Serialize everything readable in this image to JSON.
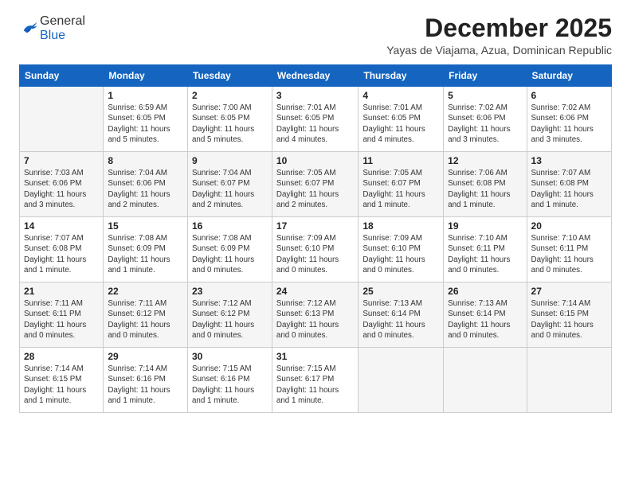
{
  "header": {
    "logo_general": "General",
    "logo_blue": "Blue",
    "month": "December 2025",
    "location": "Yayas de Viajama, Azua, Dominican Republic"
  },
  "weekdays": [
    "Sunday",
    "Monday",
    "Tuesday",
    "Wednesday",
    "Thursday",
    "Friday",
    "Saturday"
  ],
  "weeks": [
    [
      {
        "day": "",
        "info": ""
      },
      {
        "day": "1",
        "info": "Sunrise: 6:59 AM\nSunset: 6:05 PM\nDaylight: 11 hours\nand 5 minutes."
      },
      {
        "day": "2",
        "info": "Sunrise: 7:00 AM\nSunset: 6:05 PM\nDaylight: 11 hours\nand 5 minutes."
      },
      {
        "day": "3",
        "info": "Sunrise: 7:01 AM\nSunset: 6:05 PM\nDaylight: 11 hours\nand 4 minutes."
      },
      {
        "day": "4",
        "info": "Sunrise: 7:01 AM\nSunset: 6:05 PM\nDaylight: 11 hours\nand 4 minutes."
      },
      {
        "day": "5",
        "info": "Sunrise: 7:02 AM\nSunset: 6:06 PM\nDaylight: 11 hours\nand 3 minutes."
      },
      {
        "day": "6",
        "info": "Sunrise: 7:02 AM\nSunset: 6:06 PM\nDaylight: 11 hours\nand 3 minutes."
      }
    ],
    [
      {
        "day": "7",
        "info": "Sunrise: 7:03 AM\nSunset: 6:06 PM\nDaylight: 11 hours\nand 3 minutes."
      },
      {
        "day": "8",
        "info": "Sunrise: 7:04 AM\nSunset: 6:06 PM\nDaylight: 11 hours\nand 2 minutes."
      },
      {
        "day": "9",
        "info": "Sunrise: 7:04 AM\nSunset: 6:07 PM\nDaylight: 11 hours\nand 2 minutes."
      },
      {
        "day": "10",
        "info": "Sunrise: 7:05 AM\nSunset: 6:07 PM\nDaylight: 11 hours\nand 2 minutes."
      },
      {
        "day": "11",
        "info": "Sunrise: 7:05 AM\nSunset: 6:07 PM\nDaylight: 11 hours\nand 1 minute."
      },
      {
        "day": "12",
        "info": "Sunrise: 7:06 AM\nSunset: 6:08 PM\nDaylight: 11 hours\nand 1 minute."
      },
      {
        "day": "13",
        "info": "Sunrise: 7:07 AM\nSunset: 6:08 PM\nDaylight: 11 hours\nand 1 minute."
      }
    ],
    [
      {
        "day": "14",
        "info": "Sunrise: 7:07 AM\nSunset: 6:08 PM\nDaylight: 11 hours\nand 1 minute."
      },
      {
        "day": "15",
        "info": "Sunrise: 7:08 AM\nSunset: 6:09 PM\nDaylight: 11 hours\nand 1 minute."
      },
      {
        "day": "16",
        "info": "Sunrise: 7:08 AM\nSunset: 6:09 PM\nDaylight: 11 hours\nand 0 minutes."
      },
      {
        "day": "17",
        "info": "Sunrise: 7:09 AM\nSunset: 6:10 PM\nDaylight: 11 hours\nand 0 minutes."
      },
      {
        "day": "18",
        "info": "Sunrise: 7:09 AM\nSunset: 6:10 PM\nDaylight: 11 hours\nand 0 minutes."
      },
      {
        "day": "19",
        "info": "Sunrise: 7:10 AM\nSunset: 6:11 PM\nDaylight: 11 hours\nand 0 minutes."
      },
      {
        "day": "20",
        "info": "Sunrise: 7:10 AM\nSunset: 6:11 PM\nDaylight: 11 hours\nand 0 minutes."
      }
    ],
    [
      {
        "day": "21",
        "info": "Sunrise: 7:11 AM\nSunset: 6:11 PM\nDaylight: 11 hours\nand 0 minutes."
      },
      {
        "day": "22",
        "info": "Sunrise: 7:11 AM\nSunset: 6:12 PM\nDaylight: 11 hours\nand 0 minutes."
      },
      {
        "day": "23",
        "info": "Sunrise: 7:12 AM\nSunset: 6:12 PM\nDaylight: 11 hours\nand 0 minutes."
      },
      {
        "day": "24",
        "info": "Sunrise: 7:12 AM\nSunset: 6:13 PM\nDaylight: 11 hours\nand 0 minutes."
      },
      {
        "day": "25",
        "info": "Sunrise: 7:13 AM\nSunset: 6:14 PM\nDaylight: 11 hours\nand 0 minutes."
      },
      {
        "day": "26",
        "info": "Sunrise: 7:13 AM\nSunset: 6:14 PM\nDaylight: 11 hours\nand 0 minutes."
      },
      {
        "day": "27",
        "info": "Sunrise: 7:14 AM\nSunset: 6:15 PM\nDaylight: 11 hours\nand 0 minutes."
      }
    ],
    [
      {
        "day": "28",
        "info": "Sunrise: 7:14 AM\nSunset: 6:15 PM\nDaylight: 11 hours\nand 1 minute."
      },
      {
        "day": "29",
        "info": "Sunrise: 7:14 AM\nSunset: 6:16 PM\nDaylight: 11 hours\nand 1 minute."
      },
      {
        "day": "30",
        "info": "Sunrise: 7:15 AM\nSunset: 6:16 PM\nDaylight: 11 hours\nand 1 minute."
      },
      {
        "day": "31",
        "info": "Sunrise: 7:15 AM\nSunset: 6:17 PM\nDaylight: 11 hours\nand 1 minute."
      },
      {
        "day": "",
        "info": ""
      },
      {
        "day": "",
        "info": ""
      },
      {
        "day": "",
        "info": ""
      }
    ]
  ]
}
